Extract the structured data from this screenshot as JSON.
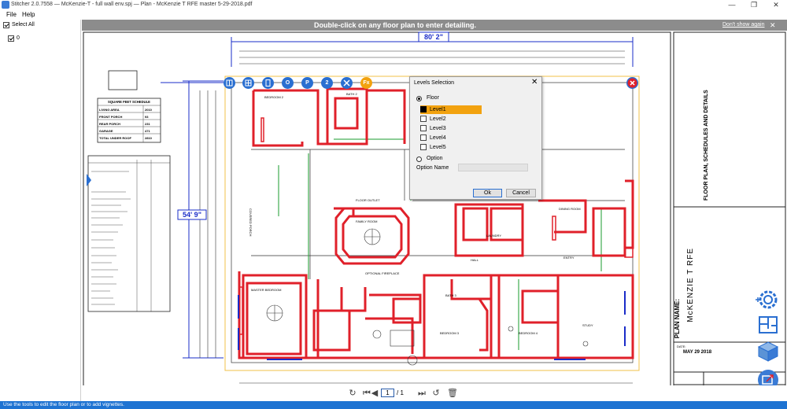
{
  "window": {
    "title": "Stitcher 2.0.7558  —  McKenzie-T - full wall env.spj  —  Plan - McKenzie T RFE master 5-29-2018.pdf",
    "minimize": "—",
    "maximize": "❐",
    "close": "✕"
  },
  "menu": {
    "file": "File",
    "help": "Help"
  },
  "left_panel": {
    "select_all": "Select All",
    "item_0": "0"
  },
  "banner": {
    "message": "Double-click on any floor plan to enter detailing.",
    "dont_show": "Don't show again",
    "close": "✕"
  },
  "toolbar": {
    "tool_o_label": "O",
    "tool_p_label": "P",
    "tool_2_label": "2",
    "tool_fx_label": "Fx"
  },
  "dialog": {
    "title": "Levels Selection",
    "close": "✕",
    "floor_label": "Floor",
    "levels": [
      "Level1",
      "Level2",
      "Level3",
      "Level4",
      "Level5"
    ],
    "selected_level": "Level1",
    "option_label": "Option",
    "option_name_label": "Option Name",
    "option_name_value": "",
    "ok": "Ok",
    "cancel": "Cancel"
  },
  "pager": {
    "current": "1",
    "separator": "/",
    "total": "1"
  },
  "status": {
    "text": "Use the tools to edit the floor plan or to add vignettes."
  },
  "plan": {
    "dim_top": "80' 2\"",
    "dim_left": "54' 9\"",
    "room_labels": [
      "BATH 2",
      "BEDROOM 2",
      "FLOOR OUTLET",
      "FAMILY ROOM",
      "MASTER BEDROOM",
      "BATH 3",
      "LAUNDRY",
      "HALL",
      "ENTRY",
      "DINING ROOM",
      "OPTIONAL FIREPLACE",
      "BEDROOM 3",
      "BEDROOM 4",
      "STUDY",
      "COVERED PORCH"
    ],
    "schedule_title": "SQUARE FEET SCHEDULE",
    "schedule_rows": [
      [
        "LIVING AREA",
        "2010"
      ],
      [
        "FRONT PORCH",
        "93"
      ],
      [
        "REAR PORCH",
        "231"
      ],
      [
        "GARAGE",
        "471"
      ],
      [
        "TOTAL UNDER ROOF",
        "2810"
      ]
    ],
    "sheet_title": "FLOOR PLAN, SCHEDULES AND DETAILS",
    "plan_name_label": "PLAN NAME:",
    "plan_name": "McKENZIE T RFE",
    "date_label": "DATE:",
    "date_value": "MAY 29 2018"
  },
  "colors": {
    "accent": "#2a6fd1",
    "wall_red": "#e0202a",
    "highlight": "#f2a20f",
    "status_bar": "#1e73d2"
  }
}
